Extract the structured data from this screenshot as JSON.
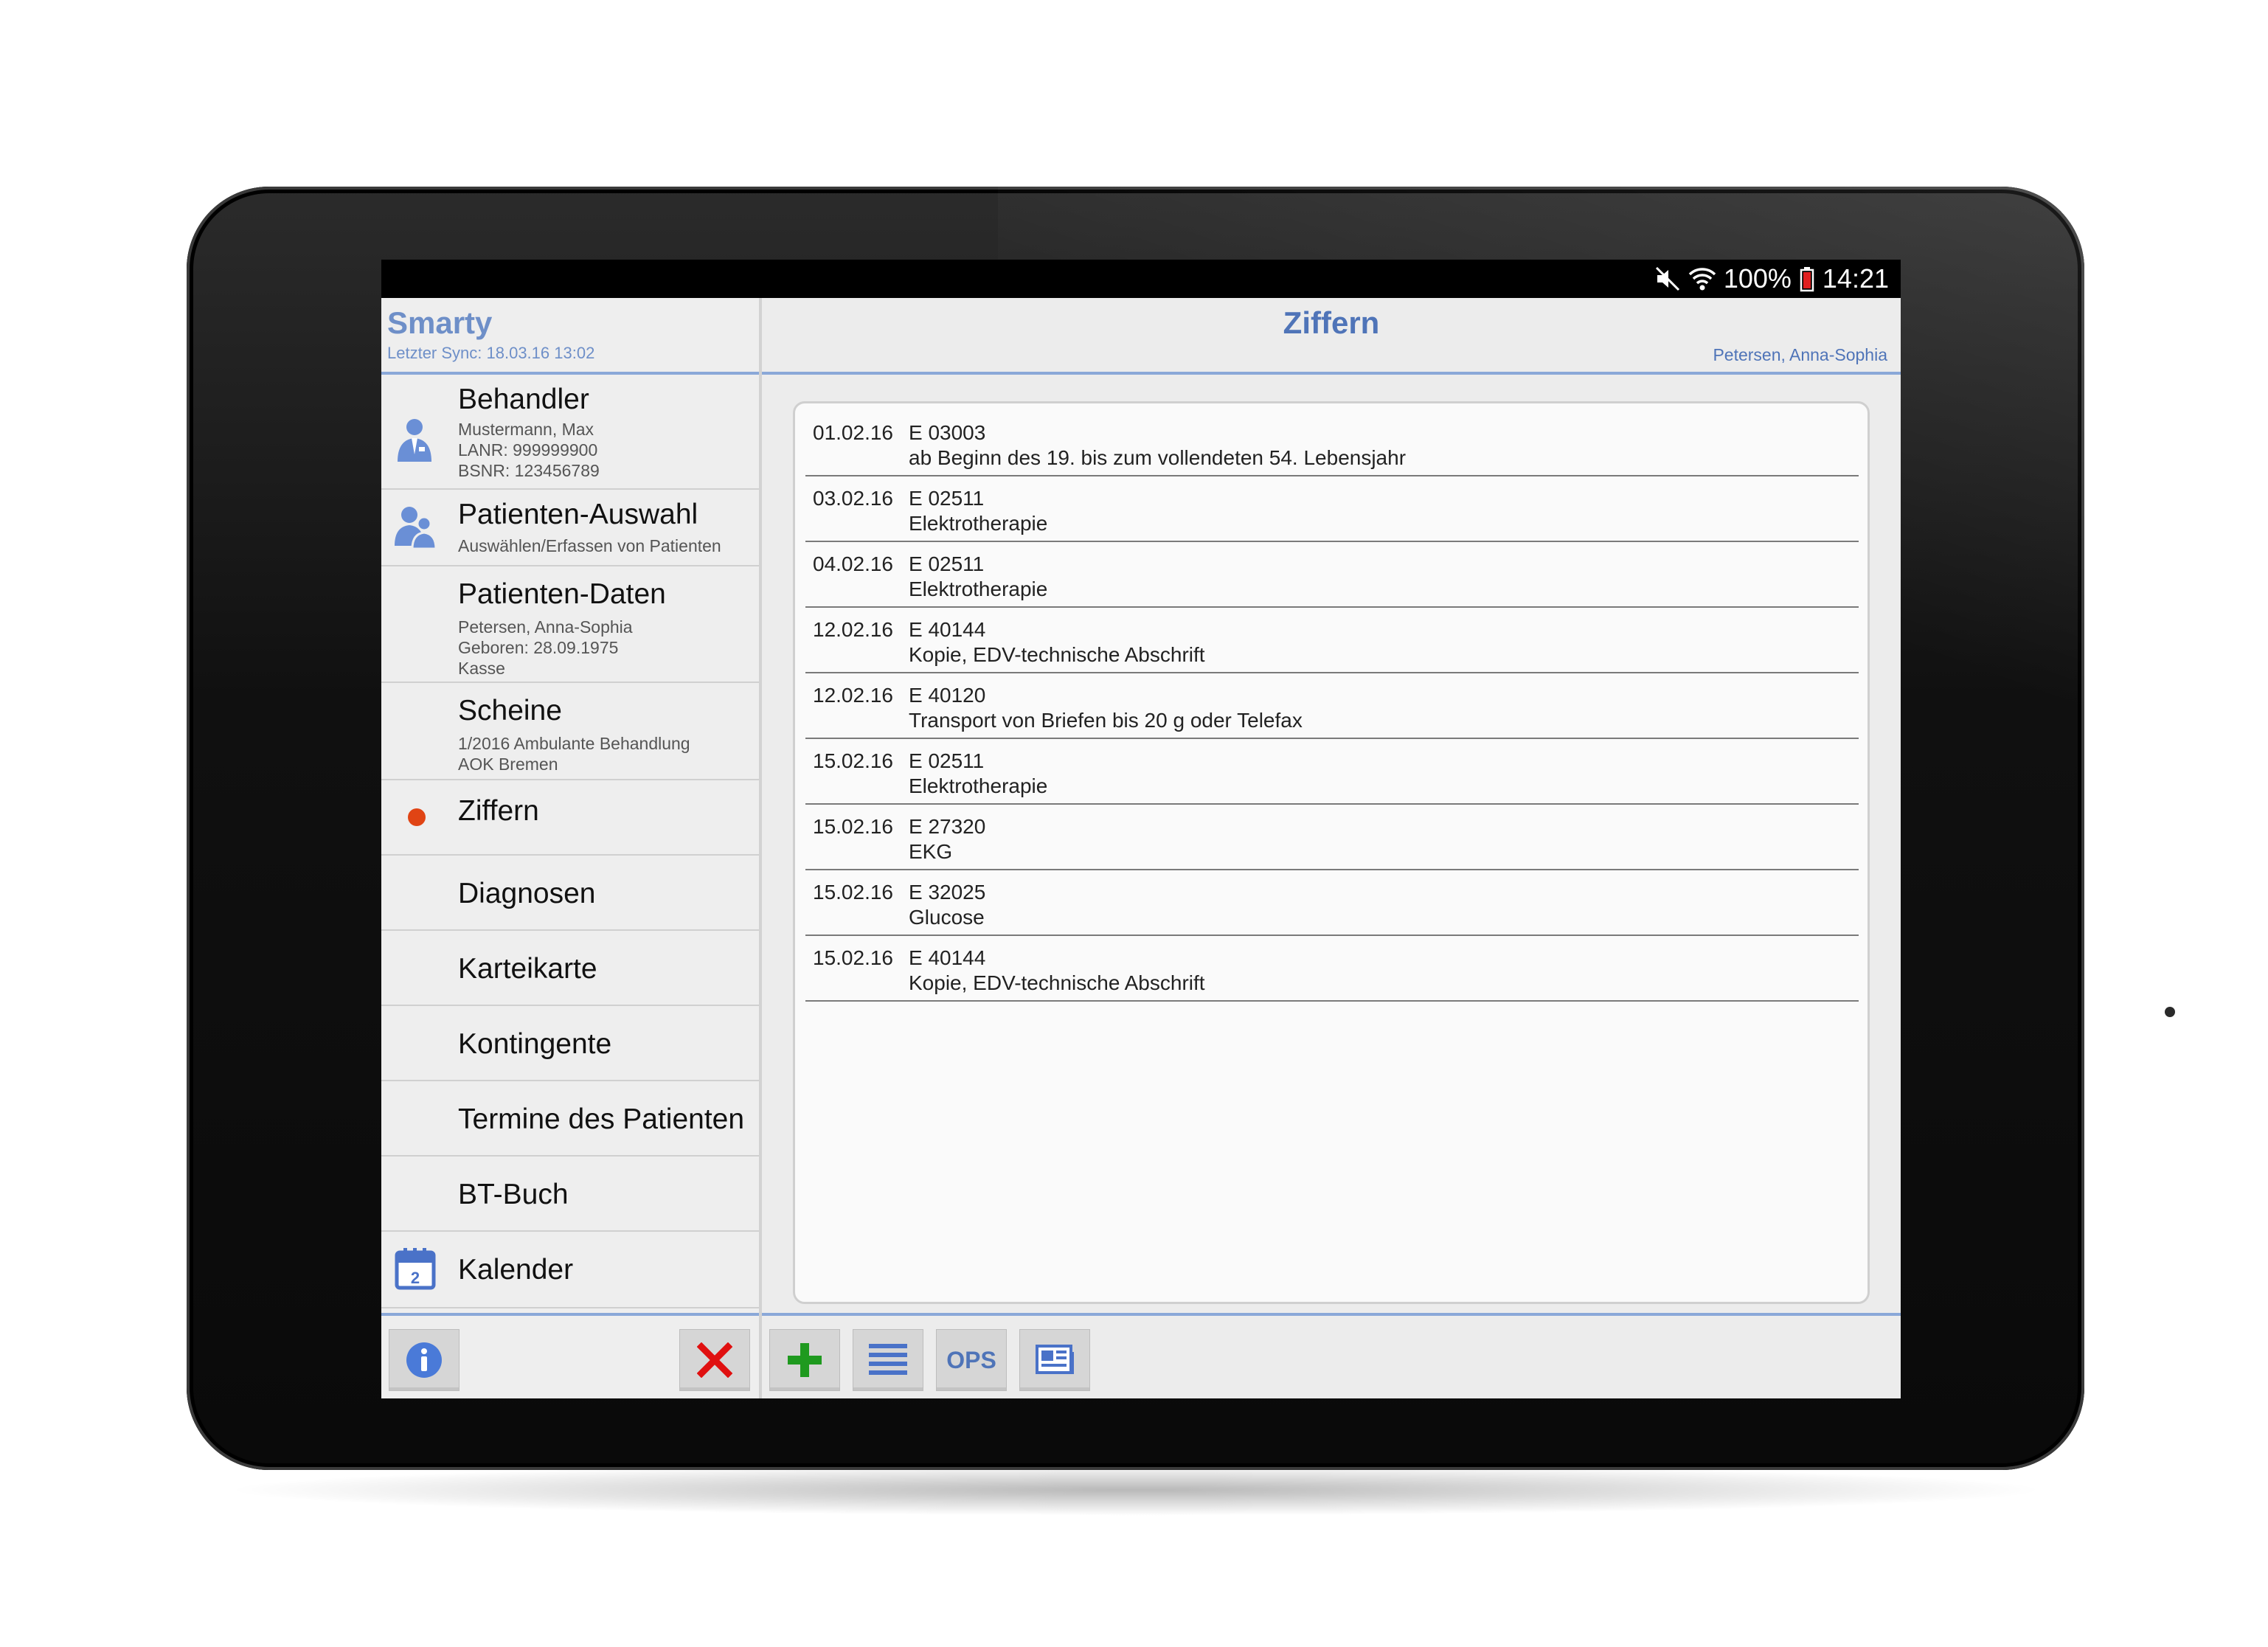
{
  "status_bar": {
    "battery": "100%",
    "time": "14:21"
  },
  "sidebar": {
    "app_title": "Smarty",
    "sync_text": "Letzter Sync: 18.03.16 13:02",
    "items": [
      {
        "label": "Behandler",
        "sub": [
          "Mustermann, Max",
          "LANR: 999999900",
          "BSNR: 123456789"
        ],
        "icon": "doctor-icon"
      },
      {
        "label": "Patienten-Auswahl",
        "sub": [
          "Auswählen/Erfassen von Patienten"
        ],
        "icon": "patients-icon"
      },
      {
        "label": "Patienten-Daten",
        "sub": [
          "Petersen, Anna-Sophia",
          "Geboren: 28.09.1975",
          "Kasse"
        ]
      },
      {
        "label": "Scheine",
        "sub": [
          "1/2016 Ambulante Behandlung",
          "AOK Bremen"
        ]
      },
      {
        "label": "Ziffern",
        "sub": [],
        "active": true
      },
      {
        "label": "Diagnosen",
        "sub": []
      },
      {
        "label": "Karteikarte",
        "sub": []
      },
      {
        "label": "Kontingente",
        "sub": []
      },
      {
        "label": "Termine des Patienten",
        "sub": []
      },
      {
        "label": "BT-Buch",
        "sub": []
      },
      {
        "label": "Kalender",
        "sub": [],
        "icon": "calendar-icon",
        "icon_text": "2"
      }
    ]
  },
  "main": {
    "title": "Ziffern",
    "patient": "Petersen, Anna-Sophia",
    "entries": [
      {
        "date": "01.02.16",
        "code": "E 03003",
        "desc": "ab Beginn des 19. bis zum vollendeten 54. Lebensjahr"
      },
      {
        "date": "03.02.16",
        "code": "E 02511",
        "desc": "Elektrotherapie"
      },
      {
        "date": "04.02.16",
        "code": "E 02511",
        "desc": "Elektrotherapie"
      },
      {
        "date": "12.02.16",
        "code": "E 40144",
        "desc": "Kopie, EDV-technische Abschrift"
      },
      {
        "date": "12.02.16",
        "code": "E 40120",
        "desc": "Transport von Briefen bis 20 g oder Telefax"
      },
      {
        "date": "15.02.16",
        "code": "E 02511",
        "desc": "Elektrotherapie"
      },
      {
        "date": "15.02.16",
        "code": "E 27320",
        "desc": "EKG"
      },
      {
        "date": "15.02.16",
        "code": "E 32025",
        "desc": "Glucose"
      },
      {
        "date": "15.02.16",
        "code": "E 40144",
        "desc": "Kopie, EDV-technische Abschrift"
      }
    ],
    "toolbar": {
      "ops_label": "OPS"
    }
  },
  "colors": {
    "accent": "#4f74b8",
    "accent_light": "#8aa8d8",
    "active_dot": "#e04414",
    "add_green": "#1f9a1f",
    "delete_red": "#e01010"
  }
}
